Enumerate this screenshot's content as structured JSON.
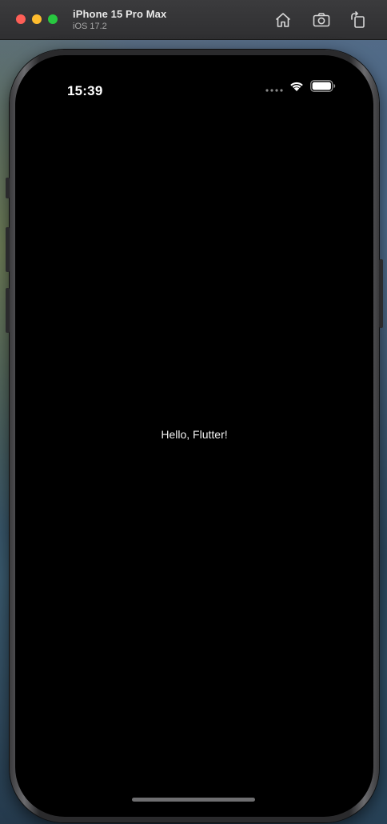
{
  "window": {
    "device_name": "iPhone 15 Pro Max",
    "os_version": "iOS 17.2",
    "toolbar_icons": [
      "home-icon",
      "screenshot-icon",
      "rotate-icon"
    ]
  },
  "status_bar": {
    "time": "15:39",
    "icons": [
      "cellular-dots-icon",
      "wifi-icon",
      "battery-icon"
    ]
  },
  "app": {
    "body_text": "Hello, Flutter!",
    "background": "#000000",
    "text_color": "#f2f2f2"
  }
}
